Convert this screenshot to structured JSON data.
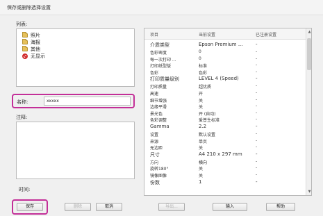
{
  "window": {
    "title": "保存或删除选择设置"
  },
  "list": {
    "label": "列表:",
    "items": [
      {
        "label": "照片",
        "icon": "folder-icon"
      },
      {
        "label": "海报",
        "icon": "folder-icon"
      },
      {
        "label": "其他",
        "icon": "folder-icon"
      },
      {
        "label": "无显示",
        "icon": "no-display-icon"
      }
    ]
  },
  "name": {
    "label": "名称:",
    "value": "xxxxx"
  },
  "notes": {
    "label": "注释:"
  },
  "time": {
    "label": "时间:"
  },
  "table": {
    "headers": {
      "item": "项目",
      "current": "当前设置",
      "registered": "已注册设置"
    },
    "rows": [
      {
        "item": "介质类型",
        "current": "Epson Premium ...",
        "reg": "-",
        "big": true
      },
      {
        "item": "色彩密度",
        "current": "0",
        "reg": "-",
        "big": false
      },
      {
        "item": "每一次打印 ...",
        "current": "0",
        "reg": "-",
        "big": false
      },
      {
        "item": "打印纸型版",
        "current": "标准",
        "reg": "-",
        "big": false
      },
      {
        "item": "色彩",
        "current": "色彩",
        "reg": "-",
        "big": false
      },
      {
        "item": "打印质量级别",
        "current": "LEVEL 4 (Speed)",
        "reg": "-",
        "big": true
      },
      {
        "item": "打印质量",
        "current": "超优质",
        "reg": "-",
        "big": false
      },
      {
        "item": "高速",
        "current": "开",
        "reg": "-",
        "big": false
      },
      {
        "item": "细节增强",
        "current": "关",
        "reg": "-",
        "big": false
      },
      {
        "item": "边缘平滑",
        "current": "关",
        "reg": "-",
        "big": false
      },
      {
        "item": "景光色",
        "current": "开 (自动)",
        "reg": "-",
        "big": false
      },
      {
        "item": "色彩调整",
        "current": "爱普生标准",
        "reg": "-",
        "big": false
      },
      {
        "item": "Gamma",
        "current": "2.2",
        "reg": "-",
        "big": true
      },
      {
        "item": "设置",
        "current": "默认设置",
        "reg": "-",
        "big": false
      },
      {
        "item": "来源",
        "current": "单页",
        "reg": "-",
        "big": false
      },
      {
        "item": "无边距",
        "current": "关",
        "reg": "-",
        "big": false
      },
      {
        "item": "尺寸",
        "current": "A4 210 x 297 mm",
        "reg": "-",
        "big": true
      },
      {
        "item": "方向",
        "current": "横向",
        "reg": "-",
        "big": false
      },
      {
        "item": "旋转180°",
        "current": "关",
        "reg": "-",
        "big": false
      },
      {
        "item": "镜像图像",
        "current": "关",
        "reg": "-",
        "big": false
      },
      {
        "item": "份数",
        "current": "1",
        "reg": "-",
        "big": true
      }
    ]
  },
  "buttons": {
    "save": "保存",
    "delete": "删除",
    "cancel": "取消",
    "export": "导出...",
    "import": "输入",
    "help": "帮助"
  },
  "colors": {
    "highlight": "#c32f98"
  }
}
